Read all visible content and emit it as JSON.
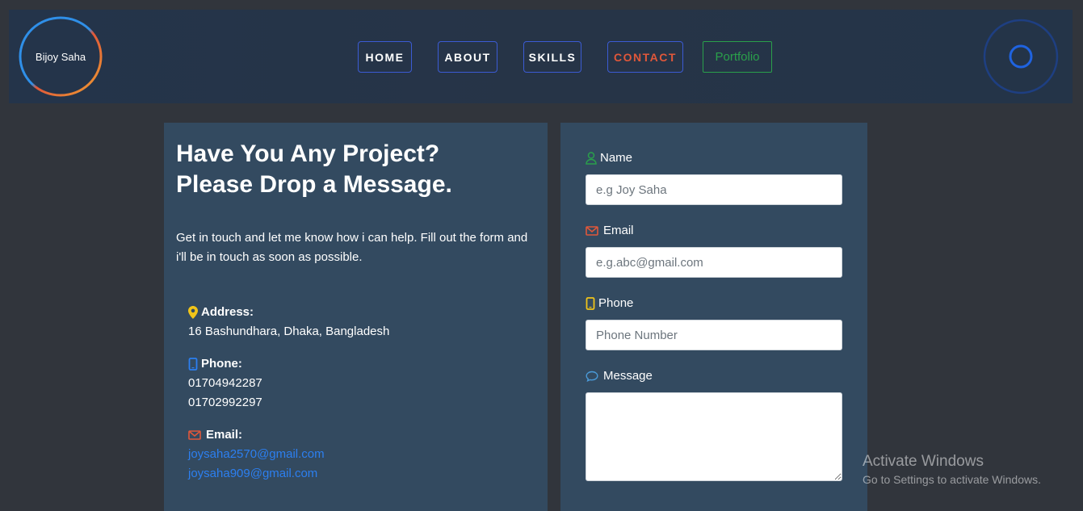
{
  "logo": {
    "text": "Bijoy Saha"
  },
  "nav": {
    "home": "HOME",
    "about": "ABOUT",
    "skills": "SKILLS",
    "contact": "CONTACT",
    "portfolio": "Portfolio"
  },
  "info": {
    "title_line1": "Have You Any Project?",
    "title_line2": "Please Drop a Message.",
    "description": "Get in touch and let me know how i can help. Fill out the form and i'll be in touch as soon as possible.",
    "address_label": "Address:",
    "address_value": "16 Bashundhara, Dhaka, Bangladesh",
    "phone_label": "Phone:",
    "phone_1": "01704942287",
    "phone_2": "01702992297",
    "email_label": "Email:",
    "email_1": "joysaha2570@gmail.com",
    "email_2": "joysaha909@gmail.com"
  },
  "form": {
    "name_label": "Name",
    "name_placeholder": "e.g Joy Saha",
    "email_label": "Email",
    "email_placeholder": "e.g.abc@gmail.com",
    "phone_label": "Phone",
    "phone_placeholder": "Phone Number",
    "message_label": "Message"
  },
  "watermark": {
    "title": "Activate Windows",
    "subtitle": "Go to Settings to activate Windows."
  },
  "colors": {
    "accent_orange": "#e0573a",
    "accent_green": "#2aa04b",
    "accent_blue": "#3b5bd4",
    "link_blue": "#2c7ff0",
    "card_bg": "#334a60",
    "page_bg": "#31353c"
  },
  "icons": {
    "address": "map-marker-icon",
    "phone": "mobile-phone-icon",
    "email": "envelope-icon",
    "name": "user-icon",
    "message": "chat-bubble-icon",
    "spinner": "loading-spinner-icon"
  }
}
